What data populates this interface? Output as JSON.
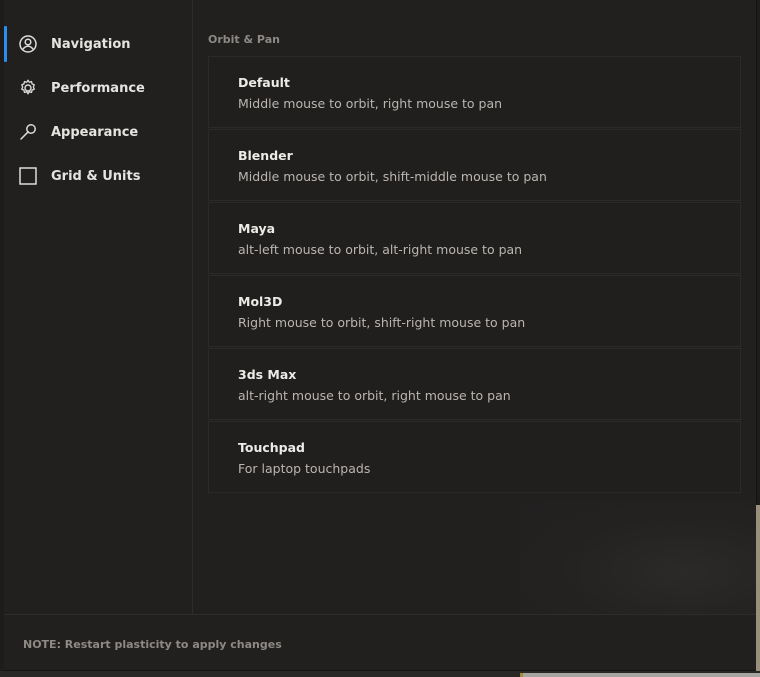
{
  "sidebar": {
    "items": [
      {
        "label": "Navigation",
        "icon": "user-circle-icon",
        "active": true
      },
      {
        "label": "Performance",
        "icon": "gear-icon",
        "active": false
      },
      {
        "label": "Appearance",
        "icon": "wrench-icon",
        "active": false
      },
      {
        "label": "Grid & Units",
        "icon": "square-icon",
        "active": false
      }
    ]
  },
  "main": {
    "section_title": "Orbit & Pan",
    "options": [
      {
        "title": "Default",
        "description": "Middle mouse to orbit, right mouse to pan"
      },
      {
        "title": "Blender",
        "description": "Middle mouse to orbit, shift-middle mouse to pan"
      },
      {
        "title": "Maya",
        "description": "alt-left mouse to orbit, alt-right mouse to pan"
      },
      {
        "title": "Mol3D",
        "description": "Right mouse to orbit, shift-right mouse to pan"
      },
      {
        "title": "3ds Max",
        "description": "alt-right mouse to orbit, right mouse to pan"
      },
      {
        "title": "Touchpad",
        "description": "For laptop touchpads"
      }
    ]
  },
  "footer": {
    "note": "NOTE: Restart plasticity to apply changes"
  },
  "colors": {
    "background": "#22201f",
    "accent": "#2d8cf0",
    "text_primary": "#e6e4e1",
    "text_secondary": "#b9b5b1",
    "text_muted": "#8d8985"
  }
}
